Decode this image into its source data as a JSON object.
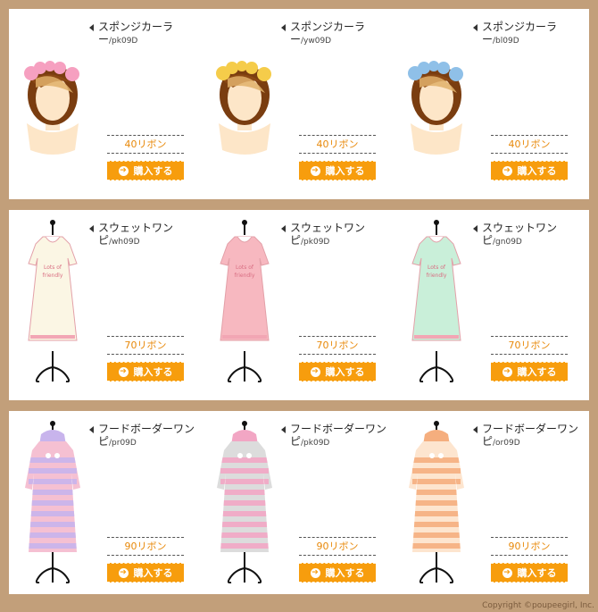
{
  "rows": [
    {
      "type": "hair",
      "items": [
        {
          "name": "スポンジカーラー",
          "code": "/pk09D",
          "price": "40リボン",
          "buy_label": "購入する",
          "color": "#f6a0c0"
        },
        {
          "name": "スポンジカーラー",
          "code": "/yw09D",
          "price": "40リボン",
          "buy_label": "購入する",
          "color": "#f5cc4a"
        },
        {
          "name": "スポンジカーラー",
          "code": "/bl09D",
          "price": "40リボン",
          "buy_label": "購入する",
          "color": "#8fc0e8"
        }
      ]
    },
    {
      "type": "dress",
      "items": [
        {
          "name": "スウェットワンピ",
          "code": "/wh09D",
          "price": "70リボン",
          "buy_label": "購入する",
          "color": "#fbf6e4"
        },
        {
          "name": "スウェットワンピ",
          "code": "/pk09D",
          "price": "70リボン",
          "buy_label": "購入する",
          "color": "#f7b8c0"
        },
        {
          "name": "スウェットワンピ",
          "code": "/gn09D",
          "price": "70リボン",
          "buy_label": "購入する",
          "color": "#c9efd9"
        }
      ]
    },
    {
      "type": "hoodie",
      "items": [
        {
          "name": "フードボーダーワンピ",
          "code": "/pr09D",
          "price": "90リボン",
          "buy_label": "購入する",
          "color": "#c8b4ec",
          "color2": "#f5c0d2"
        },
        {
          "name": "フードボーダーワンピ",
          "code": "/pk09D",
          "price": "90リボン",
          "buy_label": "購入する",
          "color": "#f2a6c4",
          "color2": "#dcdcdc"
        },
        {
          "name": "フードボーダーワンピ",
          "code": "/or09D",
          "price": "90リボン",
          "buy_label": "購入する",
          "color": "#f5ae7e",
          "color2": "#fde5cf"
        }
      ]
    }
  ],
  "copyright": "Copyright ©poupeegirl, Inc."
}
